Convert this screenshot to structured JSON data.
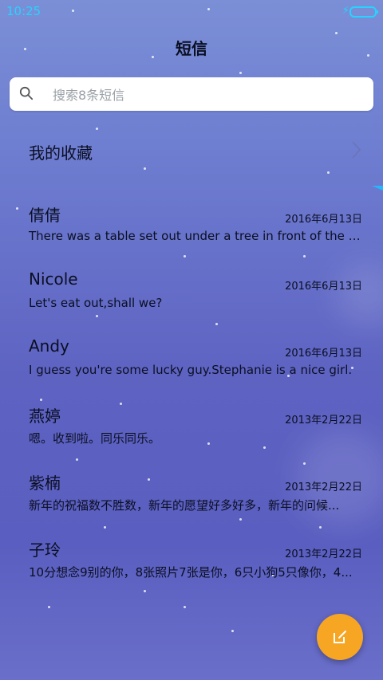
{
  "status_bar": {
    "time": "10:25"
  },
  "header": {
    "title": "短信"
  },
  "search": {
    "placeholder": "搜索8条短信"
  },
  "favorites": {
    "label": "我的收藏"
  },
  "conversations": [
    {
      "name": "倩倩",
      "date": "2016年6月13日",
      "preview": "There was a table set out under a tree in front of the ho.."
    },
    {
      "name": "Nicole",
      "date": "2016年6月13日",
      "preview": "Let's eat out,shall we?"
    },
    {
      "name": "Andy",
      "date": "2016年6月13日",
      "preview": "I guess you're some lucky guy.Stephanie is a nice girl."
    },
    {
      "name": "燕婷",
      "date": "2013年2月22日",
      "preview": "嗯。收到啦。同乐同乐。"
    },
    {
      "name": "紫楠",
      "date": "2013年2月22日",
      "preview": "新年的祝福数不胜数，新年的愿望好多好多，新年的问候..."
    },
    {
      "name": "子玲",
      "date": "2013年2月22日",
      "preview": "10分想念9别的你，8张照片7张是你，6只小狗5只像你，4..."
    }
  ],
  "colors": {
    "accent": "#27d3ff",
    "fab": "#f6a623"
  },
  "icons": {
    "search": "search-icon",
    "chevron": "chevron-right-icon",
    "compose": "compose-icon"
  }
}
